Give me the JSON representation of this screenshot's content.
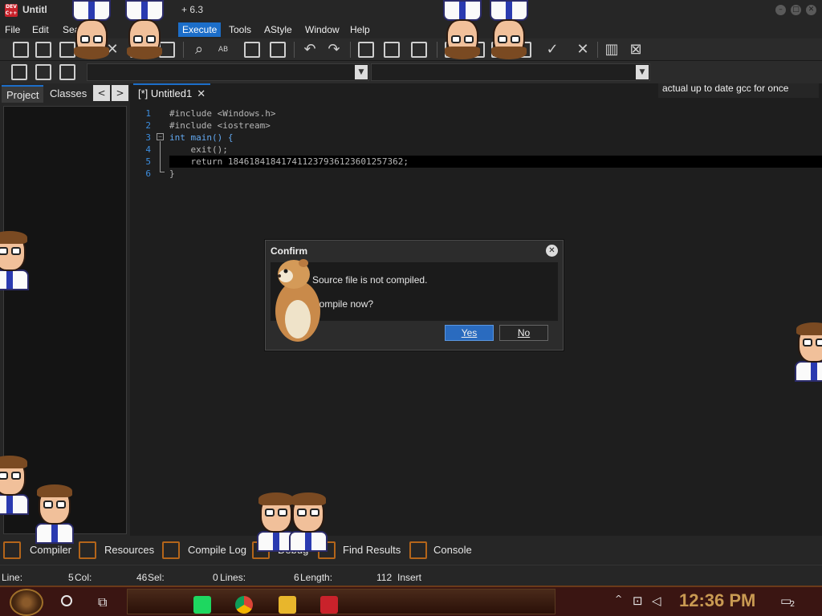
{
  "window": {
    "title": "Untitl",
    "version_fragment": "+ 6.3"
  },
  "menu": {
    "items": [
      "File",
      "Edit",
      "Sea",
      "Execute",
      "Tools",
      "AStyle",
      "Window",
      "Help"
    ]
  },
  "toolbar": {
    "compiler": "actual up to date gcc for once",
    "icons": [
      "new-file-icon",
      "open-icon",
      "save-icon",
      "save-all-icon",
      "close-icon",
      "close-all-icon",
      "print-icon",
      "find-icon",
      "replace-icon",
      "goto-icon",
      "toggle-icon",
      "undo-icon",
      "redo-icon",
      "indent-icon",
      "unindent-icon",
      "comment-icon",
      "grid-icon",
      "window-icon",
      "window-grid-icon",
      "tile-icon",
      "check-icon",
      "cross-icon",
      "chart-icon",
      "stop-icon"
    ]
  },
  "left_panel": {
    "tabs": [
      "Project",
      "Classes"
    ],
    "prev": "<",
    "next": ">"
  },
  "editor": {
    "tab_label": "[*] Untitled1",
    "tab_close": "✕",
    "line_numbers": [
      "1",
      "2",
      "3",
      "4",
      "5",
      "6"
    ],
    "lines": [
      "#include <Windows.h>",
      "#include <iostream>",
      "int main() {",
      "    exit();",
      "    return 18461841841741123793612360125736​2;",
      "}"
    ]
  },
  "dialog": {
    "title": "Confirm",
    "close": "✕",
    "message_line1": "Source file is not compiled.",
    "message_line2": "Compile now?",
    "yes": "Yes",
    "no": "No"
  },
  "bottom_tabs": [
    "Compiler",
    "Resources",
    "Compile Log",
    "Debug",
    "Find Results",
    "Console"
  ],
  "status": {
    "line": "Line:",
    "line_value": "5",
    "col": "Col:",
    "col_value": "46",
    "sel": "Sel:",
    "sel_value": "0",
    "lines": "Lines:",
    "lines_value": "6",
    "length": "Length:",
    "length_value": "112",
    "mode": "Insert"
  },
  "taskbar": {
    "clock": "12:36 PM",
    "notification_count": "2",
    "apps": [
      "spotify-icon",
      "chrome-icon",
      "file-explorer-icon",
      "devcpp-icon"
    ]
  },
  "colors": {
    "accent": "#1c6ec9",
    "keyword": "#62a8f0",
    "line_number": "#3c8dde",
    "clock": "#c99a52",
    "taskbar": "#3a1512"
  }
}
